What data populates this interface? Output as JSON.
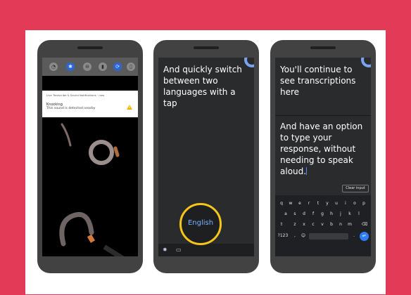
{
  "phone1": {
    "notification": {
      "app_line": "Live Transcribe & Sound Notifications · now",
      "title": "Knocking",
      "text": "This sound is detected nearby"
    }
  },
  "phone2": {
    "caption": "And quickly switch between two languages with a tap",
    "language_button": "English"
  },
  "phone3": {
    "caption_top": "You'll continue to see transcriptions here",
    "caption_typed": "And have an option to type your response, without needing to speak aloud.",
    "clear_button": "Clear input",
    "keyboard": {
      "row1": [
        "q",
        "w",
        "e",
        "r",
        "t",
        "y",
        "u",
        "i",
        "o",
        "p"
      ],
      "row2": [
        "a",
        "s",
        "d",
        "f",
        "g",
        "h",
        "j",
        "k",
        "l"
      ],
      "row3": [
        "z",
        "x",
        "c",
        "v",
        "b",
        "n",
        "m"
      ],
      "symbols_key": "?123",
      "comma_key": ",",
      "period_key": "."
    }
  },
  "colors": {
    "background": "#e33a58",
    "highlight_ring": "#f5c518",
    "accent_blue": "#2f7df6"
  }
}
